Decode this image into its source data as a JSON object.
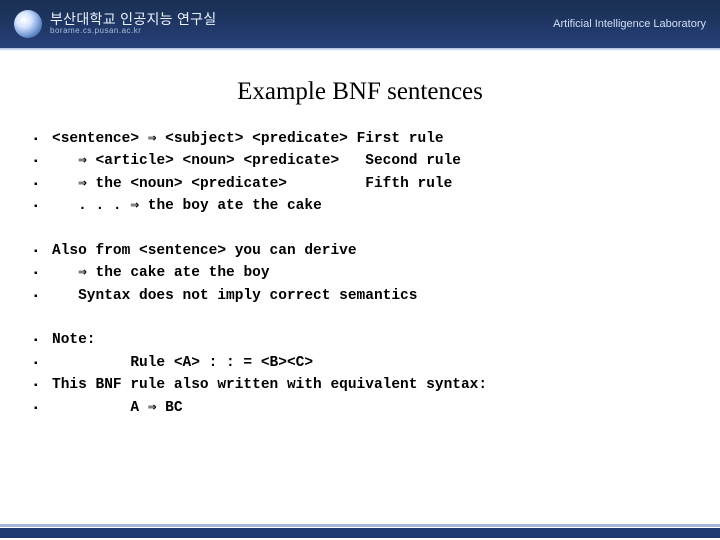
{
  "header": {
    "org": "부산대학교 인공지능 연구실",
    "url": "borame.cs.pusan.ac.kr",
    "right": "Artificial Intelligence Laboratory"
  },
  "title": "Example BNF sentences",
  "block1": {
    "l1": "<sentence> ⇒ <subject> <predicate> First rule",
    "l2": "   ⇒ <article> <noun> <predicate>   Second rule",
    "l3": "   ⇒ the <noun> <predicate>         Fifth rule",
    "l4": "   . . . ⇒ the boy ate the cake"
  },
  "block2": {
    "l1": "Also from <sentence> you can derive",
    "l2": "   ⇒ the cake ate the boy",
    "l3": "   Syntax does not imply correct semantics"
  },
  "block3": {
    "l1": "Note:",
    "l2": "         Rule <A> : : = <B><C>",
    "l3": "This BNF rule also written with equivalent syntax:",
    "l4": "         A ⇒ BC"
  },
  "bullet": "▪"
}
